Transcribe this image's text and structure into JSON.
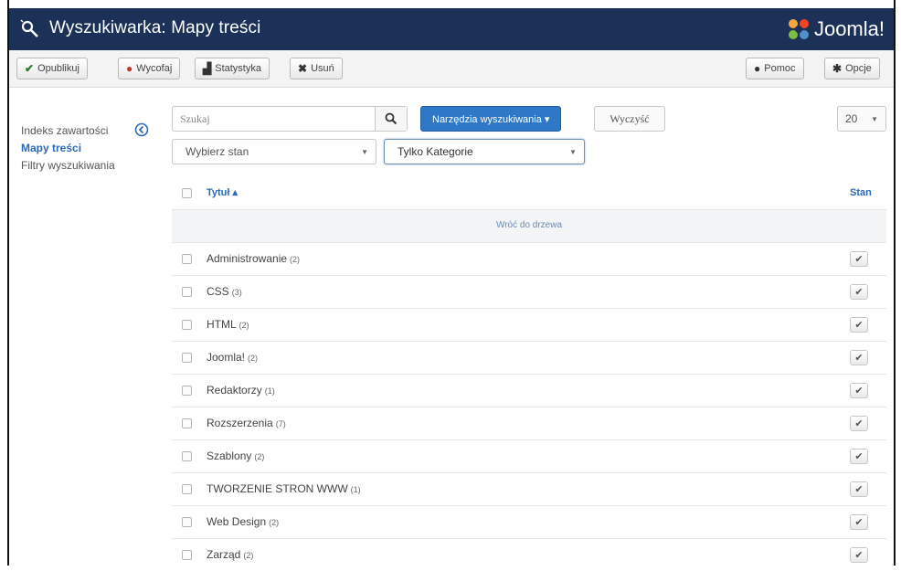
{
  "header": {
    "title": "Wyszukiwarka: Mapy treści",
    "brand": "Joomla!"
  },
  "toolbar": {
    "publish": "Opublikuj",
    "unpublish": "Wycofaj",
    "statistics": "Statystyka",
    "delete": "Usuń",
    "help": "Pomoc",
    "options": "Opcje"
  },
  "sidebar": {
    "items": [
      {
        "label": "Indeks zawartości",
        "active": false
      },
      {
        "label": "Mapy treści",
        "active": true
      },
      {
        "label": "Filtry wyszukiwania",
        "active": false
      }
    ]
  },
  "filters": {
    "search_placeholder": "Szukaj",
    "advanced_label": "Narzędzia wyszukiwania ▾",
    "clear_label": "Wyczyść",
    "limit": "20",
    "state_select": "Wybierz stan",
    "type_select": "Tylko Kategorie"
  },
  "table": {
    "col_title": "Tytuł ▴",
    "col_state": "Stan",
    "up_link": "Wróć do drzewa",
    "rows": [
      {
        "title": "Administrowanie",
        "count": "(2)"
      },
      {
        "title": "CSS",
        "count": "(3)"
      },
      {
        "title": "HTML",
        "count": "(2)"
      },
      {
        "title": "Joomla!",
        "count": "(2)"
      },
      {
        "title": "Redaktorzy",
        "count": "(1)"
      },
      {
        "title": "Rozszerzenia",
        "count": "(7)"
      },
      {
        "title": "Szablony",
        "count": "(2)"
      },
      {
        "title": "TWORZENIE STRON WWW",
        "count": "(1)"
      },
      {
        "title": "Web Design",
        "count": "(2)"
      },
      {
        "title": "Zarząd",
        "count": "(2)"
      }
    ]
  },
  "colors": {
    "header_bg": "#1b3157",
    "accent": "#2f78c8",
    "link": "#2a69b8"
  }
}
